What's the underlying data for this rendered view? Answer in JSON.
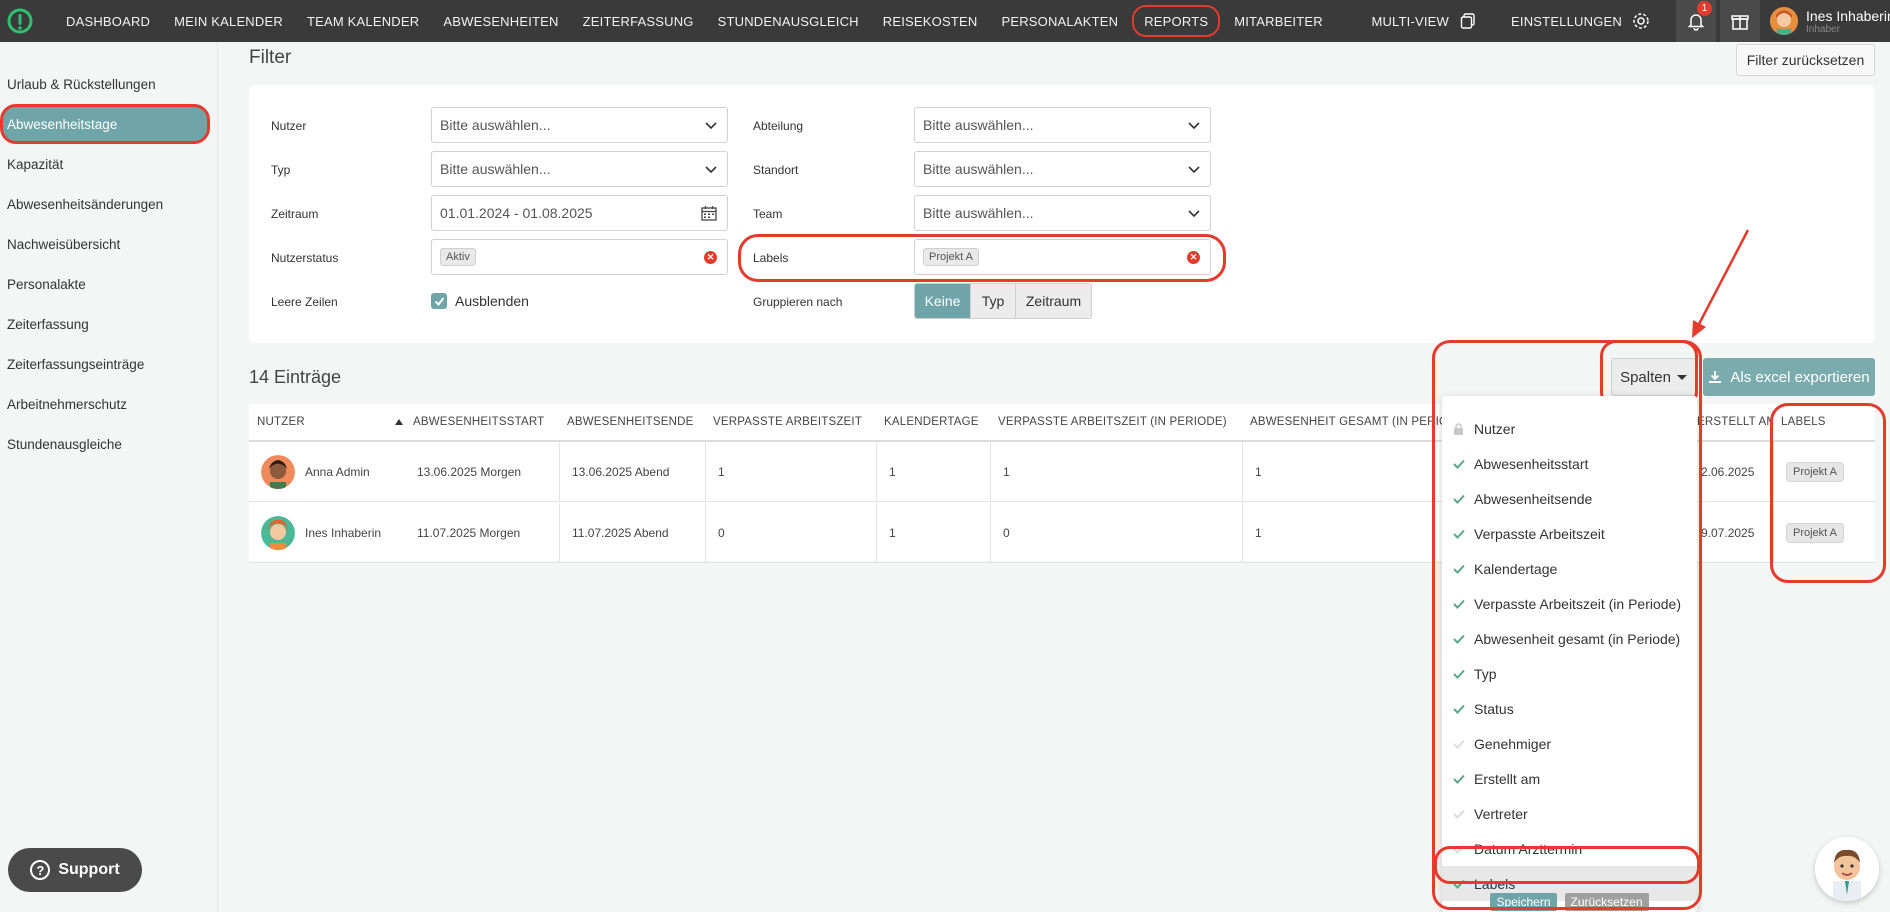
{
  "nav": {
    "items": [
      "DASHBOARD",
      "MEIN KALENDER",
      "TEAM KALENDER",
      "ABWESENHEITEN",
      "ZEITERFASSUNG",
      "STUNDENAUSGLEICH",
      "REISEKOSTEN",
      "PERSONALAKTEN",
      "REPORTS",
      "MITARBEITER"
    ],
    "active": "REPORTS",
    "multi_view": "MULTI-VIEW",
    "settings": "EINSTELLUNGEN",
    "notification_count": "1",
    "user_name": "Ines Inhaberin",
    "user_role": "Inhaber"
  },
  "sidebar": {
    "items": [
      {
        "label": "Urlaub & Rückstellungen"
      },
      {
        "label": "Abwesenheitstage"
      },
      {
        "label": "Kapazität"
      },
      {
        "label": "Abwesenheitsänderungen"
      },
      {
        "label": "Nachweisübersicht"
      },
      {
        "label": "Personalakte"
      },
      {
        "label": "Zeiterfassung"
      },
      {
        "label": "Zeiterfassungseinträge"
      },
      {
        "label": "Arbeitnehmerschutz"
      },
      {
        "label": "Stundenausgleiche"
      }
    ],
    "active": "Abwesenheitstage",
    "support": "Support"
  },
  "filter": {
    "title": "Filter",
    "reset": "Filter zurücksetzen",
    "nutzer_label": "Nutzer",
    "nutzer_value": "Bitte auswählen...",
    "typ_label": "Typ",
    "typ_value": "Bitte auswählen...",
    "zeitraum_label": "Zeitraum",
    "zeitraum_value": "01.01.2024 - 01.08.2025",
    "nutzerstatus_label": "Nutzerstatus",
    "nutzerstatus_tag": "Aktiv",
    "leere_label": "Leere Zeilen",
    "leere_value": "Ausblenden",
    "abteilung_label": "Abteilung",
    "abteilung_value": "Bitte auswählen...",
    "standort_label": "Standort",
    "standort_value": "Bitte auswählen...",
    "team_label": "Team",
    "team_value": "Bitte auswählen...",
    "labels_label": "Labels",
    "labels_tag": "Projekt A",
    "gruppieren_label": "Gruppieren nach",
    "gruppieren_options": [
      "Keine",
      "Typ",
      "Zeitraum"
    ],
    "gruppieren_selected": "Keine"
  },
  "results": {
    "count_text": "14 Einträge",
    "spalten": "Spalten",
    "export": "Als excel exportieren"
  },
  "table": {
    "columns": [
      "NUTZER",
      "ABWESENHEITSSTART",
      "ABWESENHEITSENDE",
      "VERPASSTE ARBEITSZEIT",
      "KALENDERTAGE",
      "VERPASSTE ARBEITSZEIT (IN PERIODE)",
      "ABWESENHEIT GESAMT (IN PERIODE)",
      "ERSTELLT AM",
      "LABELS"
    ],
    "rows": [
      {
        "user": "Anna Admin",
        "start": "13.06.2025 Morgen",
        "end": "13.06.2025 Abend",
        "missed": "1",
        "days": "1",
        "missed_period": "1",
        "total_period": "1",
        "created": "2.06.2025",
        "label": "Projekt A"
      },
      {
        "user": "Ines Inhaberin",
        "start": "11.07.2025 Morgen",
        "end": "11.07.2025 Abend",
        "missed": "0",
        "days": "1",
        "missed_period": "0",
        "total_period": "1",
        "created": "9.07.2025",
        "label": "Projekt A"
      }
    ]
  },
  "columns_menu": {
    "items": [
      {
        "label": "Nutzer",
        "state": "locked"
      },
      {
        "label": "Abwesenheitsstart",
        "state": "checked"
      },
      {
        "label": "Abwesenheitsende",
        "state": "checked"
      },
      {
        "label": "Verpasste Arbeitszeit",
        "state": "checked"
      },
      {
        "label": "Kalendertage",
        "state": "checked"
      },
      {
        "label": "Verpasste Arbeitszeit (in Periode)",
        "state": "checked"
      },
      {
        "label": "Abwesenheit gesamt (in Periode)",
        "state": "checked"
      },
      {
        "label": "Typ",
        "state": "checked"
      },
      {
        "label": "Status",
        "state": "checked"
      },
      {
        "label": "Genehmiger",
        "state": "unchecked"
      },
      {
        "label": "Erstellt am",
        "state": "checked"
      },
      {
        "label": "Vertreter",
        "state": "unchecked"
      },
      {
        "label": "Datum Arzttermin",
        "state": "unchecked"
      },
      {
        "label": "Labels",
        "state": "checked"
      }
    ],
    "save": "Speichern",
    "reset": "Zurücksetzen"
  },
  "colors": {
    "accent": "#6fa5a8",
    "annotation": "#e53b2c",
    "nav_bg": "#3a3a3a",
    "check": "#5aa88a"
  }
}
